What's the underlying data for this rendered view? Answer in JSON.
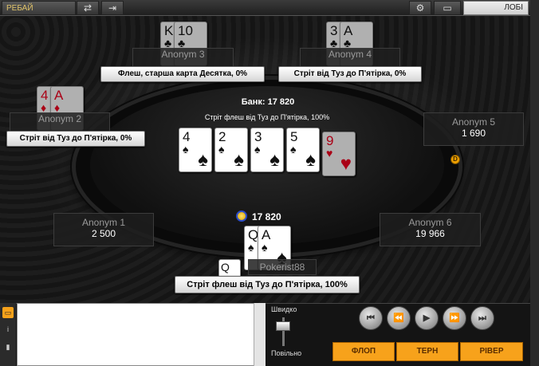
{
  "topbar": {
    "rebuy_label": "РЕБАЙ",
    "refresh_icon": "⇄",
    "exit_icon": "⇥",
    "settings_icon": "⚙",
    "layout_icon": "▭",
    "lobby_label": "ЛОБІ"
  },
  "table": {
    "pot_label": "Банк: 17 820",
    "board_description": "Стріт флеш від Туз до П'ятірка, 100%",
    "board_cards": [
      {
        "rank": "4",
        "suit": "♠",
        "color": "black"
      },
      {
        "rank": "2",
        "suit": "♠",
        "color": "black"
      },
      {
        "rank": "3",
        "suit": "♠",
        "color": "black"
      },
      {
        "rank": "5",
        "suit": "♠",
        "color": "black"
      },
      {
        "rank": "9",
        "suit": "♥",
        "color": "red"
      }
    ],
    "hero_bet": "17 820"
  },
  "players": {
    "anonym3": {
      "name": "Anonym 3",
      "hand": "Флеш, старша карта Десятка, 0%",
      "cards": [
        {
          "rank": "K",
          "suit": "♣"
        },
        {
          "rank": "10",
          "suit": "♣"
        }
      ]
    },
    "anonym4": {
      "name": "Anonym 4",
      "hand": "Стріт від Туз до П'ятірка, 0%",
      "cards": [
        {
          "rank": "3",
          "suit": "♣"
        },
        {
          "rank": "A",
          "suit": "♣"
        }
      ]
    },
    "anonym2": {
      "name": "Anonym 2",
      "hand": "Стріт від Туз до П'ятірка, 0%",
      "cards": [
        {
          "rank": "4",
          "suit": "♦"
        },
        {
          "rank": "A",
          "suit": "♦"
        }
      ]
    },
    "anonym5": {
      "name": "Anonym 5",
      "stack": "1 690"
    },
    "anonym1": {
      "name": "Anonym 1",
      "stack": "2 500"
    },
    "anonym6": {
      "name": "Anonym 6",
      "stack": "19 966"
    },
    "hero": {
      "name": "Pokerist88",
      "hand": "Стріт флеш від Туз до П'ятірка, 100%",
      "cards": [
        {
          "rank": "Q",
          "suit": "♠"
        },
        {
          "rank": "A",
          "suit": "♠"
        }
      ]
    }
  },
  "dealer_button": "D",
  "controls": {
    "fast_label": "Швидко",
    "slow_label": "Повільно",
    "buttons": [
      "⏮",
      "⏪",
      "▶",
      "⏩",
      "⏭"
    ],
    "streets": [
      "ФЛОП",
      "ТЕРН",
      "РІВЕР"
    ]
  },
  "colors": {
    "accent": "#f7a21b",
    "highlight": "#e0c36a"
  }
}
